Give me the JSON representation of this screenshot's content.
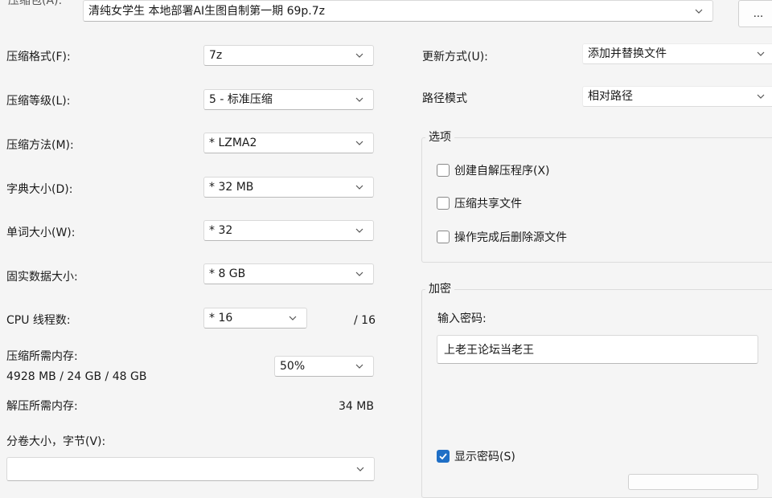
{
  "archive": {
    "label": "压缩包(A):",
    "value": "清纯女学生 本地部署AI生图自制第一期 69p.7z",
    "browse_label": "..."
  },
  "left": {
    "format": {
      "label": "压缩格式(F):",
      "value": "7z"
    },
    "level": {
      "label": "压缩等级(L):",
      "value": "5 - 标准压缩"
    },
    "method": {
      "label": "压缩方法(M):",
      "value": "*  LZMA2"
    },
    "dictionary": {
      "label": "字典大小(D):",
      "value": "*  32 MB"
    },
    "word": {
      "label": "单词大小(W):",
      "value": "*  32"
    },
    "solid": {
      "label": "固实数据大小:",
      "value": "*  8 GB"
    },
    "threads": {
      "label": "CPU 线程数:",
      "value": "*  16",
      "max": "/ 16"
    },
    "memory_compress": {
      "label": "压缩所需内存:",
      "detail": "4928 MB / 24 GB / 48 GB",
      "value": "50%"
    },
    "memory_decompress": {
      "label": "解压所需内存:",
      "value": "34 MB"
    },
    "volume": {
      "label": "分卷大小，字节(V):",
      "value": ""
    }
  },
  "right": {
    "update": {
      "label": "更新方式(U):",
      "value": "添加并替换文件"
    },
    "path": {
      "label": "路径模式",
      "value": "相对路径"
    },
    "options": {
      "title": "选项",
      "items": [
        {
          "label": "创建自解压程序(X)",
          "checked": false
        },
        {
          "label": "压缩共享文件",
          "checked": false
        },
        {
          "label": "操作完成后删除源文件",
          "checked": false
        }
      ]
    },
    "encryption": {
      "title": "加密",
      "password_label": "输入密码:",
      "password_value": "上老王论坛当老王",
      "show_password_label": "显示密码(S)",
      "show_password_checked": true
    }
  },
  "colors": {
    "accent": "#1f6fc6",
    "background": "#f5f5f5"
  }
}
